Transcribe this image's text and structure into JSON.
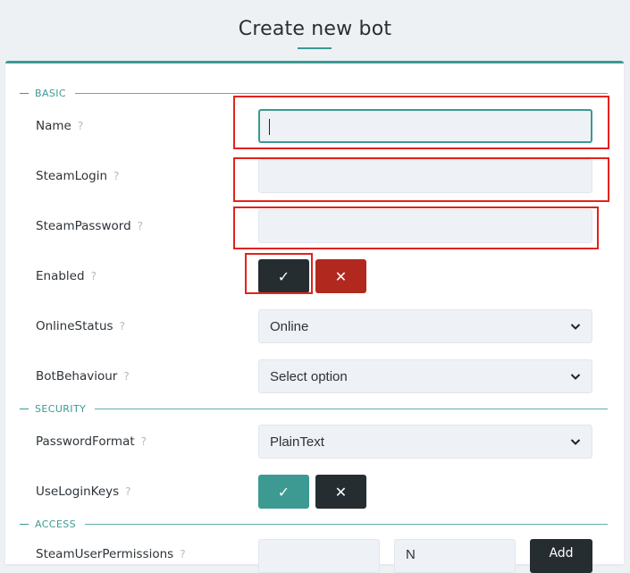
{
  "page": {
    "title": "Create new bot"
  },
  "sections": {
    "basic": "BASIC",
    "security": "SECURITY",
    "access": "ACCESS"
  },
  "help_glyph": "?",
  "fields": {
    "name": {
      "label": "Name",
      "value": ""
    },
    "steam_login": {
      "label": "SteamLogin",
      "value": ""
    },
    "steam_password": {
      "label": "SteamPassword",
      "value": ""
    },
    "enabled": {
      "label": "Enabled",
      "state": "true"
    },
    "online_status": {
      "label": "OnlineStatus",
      "selected": "Online"
    },
    "bot_behaviour": {
      "label": "BotBehaviour",
      "selected": "Select option"
    },
    "password_format": {
      "label": "PasswordFormat",
      "selected": "PlainText"
    },
    "use_login_keys": {
      "label": "UseLoginKeys",
      "state": "true"
    },
    "steam_user_permissions": {
      "label": "SteamUserPermissions",
      "value_partial": "N",
      "add_label": "Add"
    }
  },
  "toggle_glyphs": {
    "yes": "✓",
    "no": "✕"
  },
  "colors": {
    "accent": "#3c9a93",
    "dark_button": "#262d31",
    "danger_button": "#b1281f",
    "annotation": "#e2231a"
  }
}
